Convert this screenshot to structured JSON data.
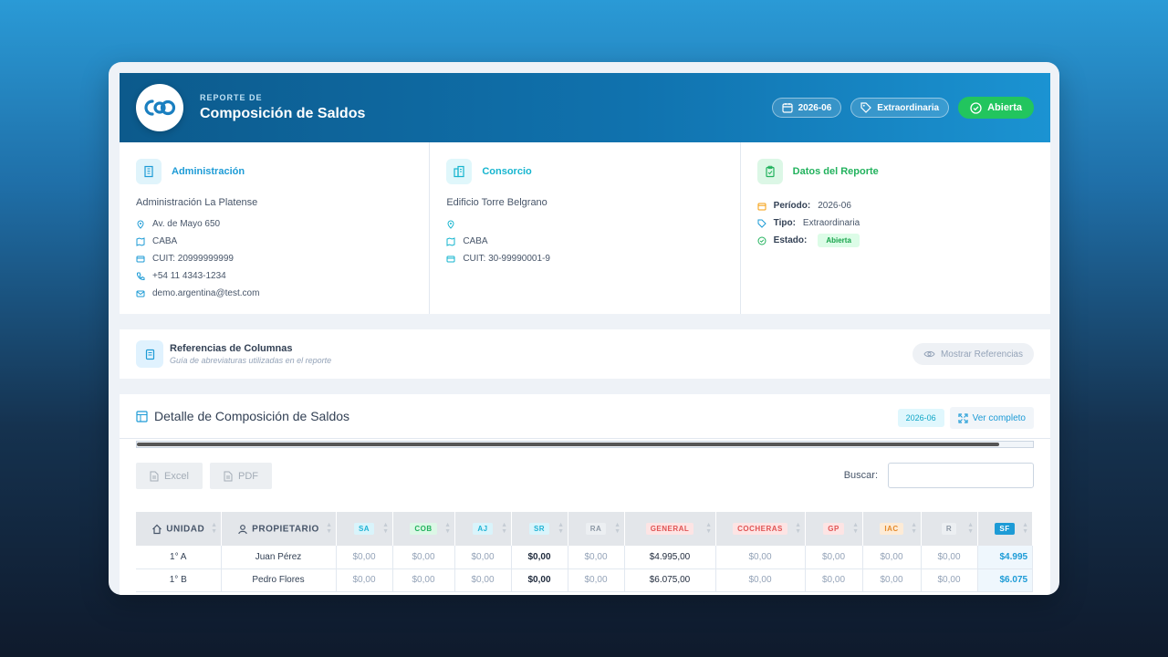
{
  "header": {
    "subtitle": "REPORTE DE",
    "title": "Composición de Saldos",
    "period": "2026-06",
    "type": "Extraordinaria",
    "status": "Abierta"
  },
  "admin": {
    "title": "Administración",
    "name": "Administración La Platense",
    "address": "Av. de Mayo 650",
    "city": "CABA",
    "cuit": "CUIT: 20999999999",
    "phone": "+54 11 4343-1234",
    "email": "demo.argentina@test.com"
  },
  "consorcio": {
    "title": "Consorcio",
    "name": "Edificio Torre Belgrano",
    "address": "",
    "city": "CABA",
    "cuit": "CUIT: 30-99990001-9"
  },
  "report": {
    "title": "Datos del Reporte",
    "period_label": "Período:",
    "period_value": "2026-06",
    "type_label": "Tipo:",
    "type_value": "Extraordinaria",
    "status_label": "Estado:",
    "status_value": "Abierta"
  },
  "references": {
    "title": "Referencias de Columnas",
    "subtitle": "Guía de abreviaturas utilizadas en el reporte",
    "button": "Mostrar Referencias"
  },
  "detail": {
    "title": "Detalle de Composición de Saldos",
    "period_chip": "2026-06",
    "view_full": "Ver completo",
    "excel": "Excel",
    "pdf": "PDF",
    "search_label": "Buscar:",
    "search_value": ""
  },
  "table": {
    "columns": [
      {
        "label": "UNIDAD"
      },
      {
        "label": "PROPIETARIO"
      },
      {
        "label": "SA",
        "bg": "#d9f4fb",
        "fg": "#1fb2d4"
      },
      {
        "label": "COB",
        "bg": "#dcf7e6",
        "fg": "#22b25d"
      },
      {
        "label": "AJ",
        "bg": "#d9f4fb",
        "fg": "#1fb2d4"
      },
      {
        "label": "SR",
        "bg": "#d9f4fb",
        "fg": "#1fb2d4"
      },
      {
        "label": "RA",
        "bg": "#eceff2",
        "fg": "#8c97a4"
      },
      {
        "label": "GENERAL",
        "bg": "#fde4e4",
        "fg": "#e05353"
      },
      {
        "label": "COCHERAS",
        "bg": "#fde4e4",
        "fg": "#e05353"
      },
      {
        "label": "GP",
        "bg": "#fde4e4",
        "fg": "#e05353"
      },
      {
        "label": "IAC",
        "bg": "#fdebd6",
        "fg": "#e58a2a"
      },
      {
        "label": "R",
        "bg": "#eceff2",
        "fg": "#8c97a4"
      },
      {
        "label": "SF",
        "bg": "#1d9bd6",
        "fg": "#ffffff"
      }
    ],
    "rows": [
      {
        "cells": [
          "1° A",
          "Juan Pérez",
          "$0,00",
          "$0,00",
          "$0,00",
          "$0,00",
          "$0,00",
          "$4.995,00",
          "$0,00",
          "$0,00",
          "$0,00",
          "$0,00",
          "$4.995"
        ]
      },
      {
        "cells": [
          "1° B",
          "Pedro Flores",
          "$0,00",
          "$0,00",
          "$0,00",
          "$0,00",
          "$0,00",
          "$6.075,00",
          "$0,00",
          "$0,00",
          "$0,00",
          "$0,00",
          "$6.075"
        ]
      }
    ]
  }
}
